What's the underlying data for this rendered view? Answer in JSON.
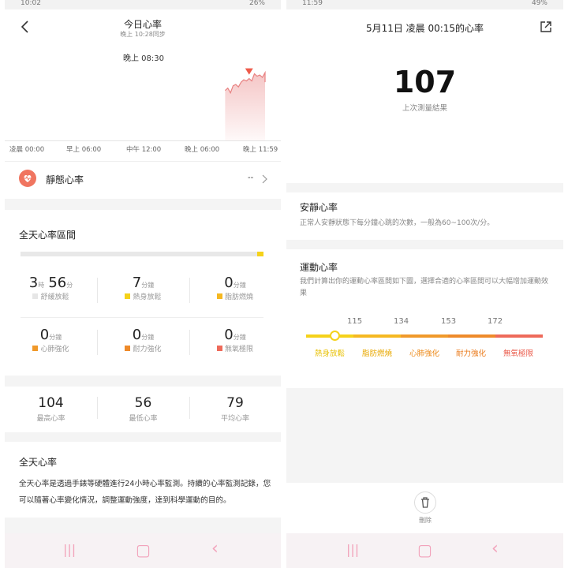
{
  "left": {
    "status": {
      "time": "10:02",
      "right": "26%"
    },
    "header": {
      "title": "今日心率",
      "subtitle": "晚上 10:28同步",
      "back_icon": "chevron-left-icon"
    },
    "tooltip_time": "晚上 08:30",
    "x_ticks": [
      "凌晨 00:00",
      "早上 06:00",
      "中午 12:00",
      "晚上 06:00",
      "晚上 11:59"
    ],
    "resting": {
      "icon": "heart-icon",
      "label": "靜態心率",
      "value": "--"
    },
    "zones": {
      "title": "全天心率區間",
      "items": [
        {
          "h": "3",
          "h_unit": "時",
          "m": "56",
          "m_unit": "分",
          "label": "舒緩放鬆",
          "color": "#e6e6e6"
        },
        {
          "m": "7",
          "m_unit": "分鐘",
          "label": "熱身放鬆",
          "color": "#f5d21a"
        },
        {
          "m": "0",
          "m_unit": "分鐘",
          "label": "脂肪燃燒",
          "color": "#f5b821"
        },
        {
          "m": "0",
          "m_unit": "分鐘",
          "label": "心肺強化",
          "color": "#f0992a"
        },
        {
          "m": "0",
          "m_unit": "分鐘",
          "label": "耐力強化",
          "color": "#ee8a2a"
        },
        {
          "m": "0",
          "m_unit": "分鐘",
          "label": "無氧極限",
          "color": "#ee6a5a"
        }
      ]
    },
    "stats": [
      {
        "value": "104",
        "label": "最高心率"
      },
      {
        "value": "56",
        "label": "最低心率"
      },
      {
        "value": "79",
        "label": "平均心率"
      }
    ],
    "info": {
      "title": "全天心率",
      "body": "全天心率是透過手錶等硬體進行24小時心率監測。持續的心率監測記錄，您可以隨著心率變化情況，調整運動強度，達到科學運動的目的。"
    }
  },
  "right": {
    "status": {
      "time": "11:59",
      "right": "49%"
    },
    "header": {
      "title": "5月11日 凌晨 00:15的心率",
      "share_icon": "share-icon"
    },
    "reading": {
      "value": "107",
      "caption": "上次測量結果"
    },
    "resting": {
      "title": "安靜心率",
      "desc": "正常人安靜狀態下每分鐘心跳的次數，一般為60~100次/分。"
    },
    "exercise": {
      "title": "運動心率",
      "desc": "我們計算出你的運動心率區間如下圖，選擇合適的心率區間可以大幅增加運動效果",
      "thresholds": [
        "115",
        "134",
        "153",
        "172"
      ],
      "zones": [
        {
          "label": "熱身放鬆",
          "color": "#f5d21a"
        },
        {
          "label": "脂肪燃燒",
          "color": "#f5b821"
        },
        {
          "label": "心肺強化",
          "color": "#f0992a"
        },
        {
          "label": "耐力強化",
          "color": "#ee8a2a"
        },
        {
          "label": "無氧極限",
          "color": "#ee6a5a"
        }
      ]
    },
    "delete": {
      "icon": "trash-icon",
      "label": "刪除"
    }
  },
  "nav": {
    "recent_icon": "recent-apps-icon",
    "home_icon": "home-icon",
    "back_icon": "back-icon"
  },
  "chart_data": {
    "type": "area",
    "x_ticks": [
      "凌晨 00:00",
      "早上 06:00",
      "中午 12:00",
      "晚上 06:00",
      "晚上 11:59"
    ],
    "x_hours": [
      20.25,
      20.5,
      20.75,
      21.0,
      21.25,
      21.5,
      21.75,
      22.0,
      22.25,
      22.5,
      22.75,
      23.0,
      23.25,
      23.5,
      23.75,
      24.0,
      24.25
    ],
    "values": [
      92,
      94,
      90,
      96,
      97,
      95,
      99,
      101,
      100,
      102,
      100,
      106,
      104,
      105,
      103,
      107,
      99
    ],
    "marker": {
      "time": "晚上 08:30",
      "hour": 22.5
    },
    "ylim": [
      50,
      115
    ],
    "color": "#e88080"
  }
}
